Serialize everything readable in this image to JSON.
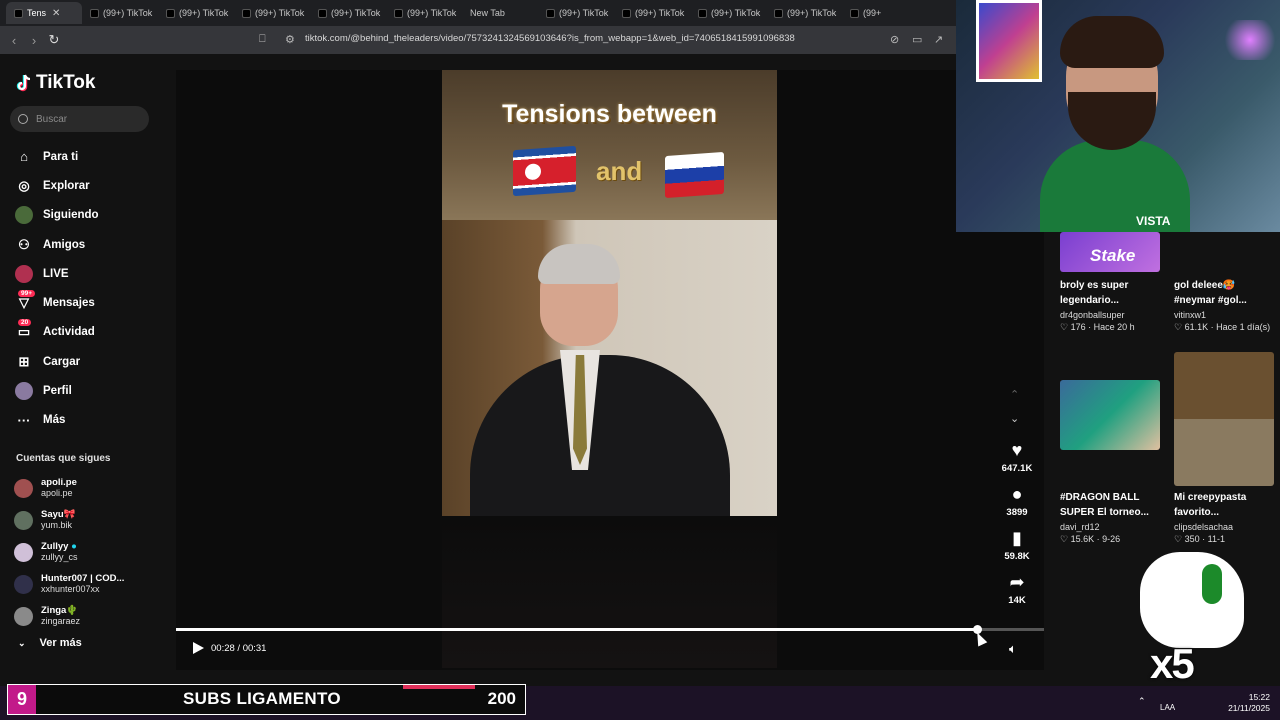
{
  "browser": {
    "tabs": [
      {
        "label": "Tens",
        "active": true
      },
      {
        "label": "(99+) TikTok"
      },
      {
        "label": "(99+) TikTok"
      },
      {
        "label": "(99+) TikTok"
      },
      {
        "label": "(99+) TikTok"
      },
      {
        "label": "(99+) TikTok"
      },
      {
        "label": "New Tab"
      },
      {
        "label": "(99+) TikTok"
      },
      {
        "label": "(99+) TikTok"
      },
      {
        "label": "(99+) TikTok"
      },
      {
        "label": "(99+) TikTok"
      },
      {
        "label": "(99+) TikTok"
      },
      {
        "label": "(99+"
      }
    ],
    "url": "tiktok.com/@behind_theleaders/video/7573241324569103646?is_from_webapp=1&web_id=7406518415991096838"
  },
  "sidebar": {
    "logo": "TikTok",
    "search_placeholder": "Buscar",
    "nav": [
      {
        "label": "Para ti",
        "icon": "home-icon"
      },
      {
        "label": "Explorar",
        "icon": "compass-icon"
      },
      {
        "label": "Siguiendo",
        "icon": "avatar-icon"
      },
      {
        "label": "Amigos",
        "icon": "friends-icon"
      },
      {
        "label": "LIVE",
        "icon": "live-icon"
      },
      {
        "label": "Mensajes",
        "icon": "messages-icon",
        "badge": "99+"
      },
      {
        "label": "Actividad",
        "icon": "activity-icon",
        "badge": "20"
      },
      {
        "label": "Cargar",
        "icon": "upload-icon"
      },
      {
        "label": "Perfil",
        "icon": "profile-icon"
      },
      {
        "label": "Más",
        "icon": "more-icon"
      }
    ],
    "following_header": "Cuentas que sigues",
    "following": [
      {
        "name": "apoli.pe",
        "handle": "apoli.pe"
      },
      {
        "name": "Sayu🎀",
        "handle": "yum.bik"
      },
      {
        "name": "Zullyy",
        "handle": "zullyy_cs"
      },
      {
        "name": "Hunter007 | COD...",
        "handle": "xxhunter007xx"
      },
      {
        "name": "Zinga🌵",
        "handle": "zingaraez"
      }
    ],
    "see_more": "Ver más"
  },
  "video": {
    "title_line": "Tensions between",
    "and_text": "and",
    "time": "00:28 / 00:31",
    "progress": 0.923
  },
  "actions": {
    "likes": "647.1K",
    "comments": "3899",
    "saves": "59.8K",
    "shares": "14K"
  },
  "suggestions": [
    {
      "title": "broly es super legendario...",
      "user": "dr4gonballsuper",
      "likes": "176",
      "age": "Hace 20 h",
      "thumb_text": "Stake"
    },
    {
      "title": "gol deleee🥵 #neymar #gol...",
      "user": "vitinxw1",
      "likes": "61.1K",
      "age": "Hace 1 día(s)"
    },
    {
      "title": "#DRAGON BALL SUPER El torneo...",
      "user": "davi_rd12",
      "likes": "15.6K",
      "age": "9-26"
    },
    {
      "title": "Mi creepypasta favorito...",
      "user": "clipsdelsachaa",
      "likes": "350",
      "age": "11-1"
    }
  ],
  "overlay": {
    "subs_count": "9",
    "subs_label": "SUBS LIGAMENTO",
    "subs_goal": "200",
    "multiplier": "x5",
    "jersey_text": "VISTA"
  },
  "taskbar": {
    "lang": "LAA",
    "time": "15:22",
    "date": "21/11/2025"
  },
  "colors": {
    "accent": "#fe2c55",
    "background": "#121212",
    "subs_badge": "#c21a8a"
  }
}
